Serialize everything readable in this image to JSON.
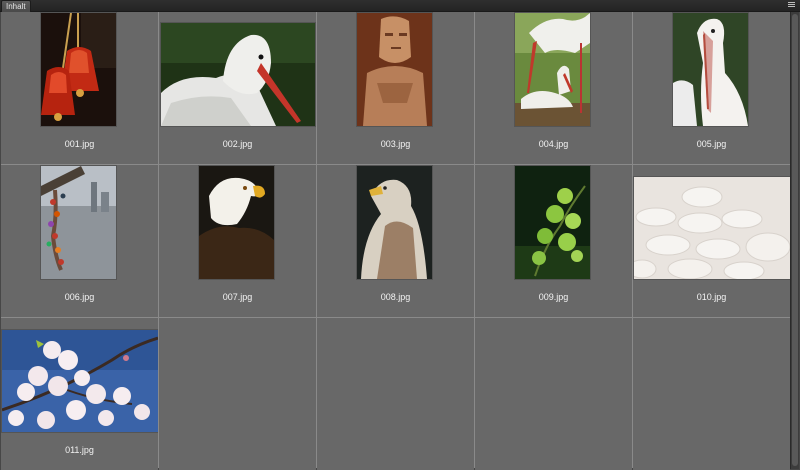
{
  "window": {
    "tab_label": "Inhalt"
  },
  "items": [
    {
      "filename": "001.jpg",
      "subject": "red-christmas-bells"
    },
    {
      "filename": "002.jpg",
      "subject": "white-stork-closeup"
    },
    {
      "filename": "003.jpg",
      "subject": "carved-stone-figure"
    },
    {
      "filename": "004.jpg",
      "subject": "storks-at-nest"
    },
    {
      "filename": "005.jpg",
      "subject": "pelican-closeup"
    },
    {
      "filename": "006.jpg",
      "subject": "love-locks-on-bridge"
    },
    {
      "filename": "007.jpg",
      "subject": "bald-eagle"
    },
    {
      "filename": "008.jpg",
      "subject": "egyptian-vulture"
    },
    {
      "filename": "009.jpg",
      "subject": "green-branch"
    },
    {
      "filename": "010.jpg",
      "subject": "white-tablets"
    },
    {
      "filename": "011.jpg",
      "subject": "cherry-blossoms"
    }
  ],
  "colors": {
    "panel_bg": "#686868",
    "grid_line": "#8a8a8a",
    "titlebar": "#2a2a2a",
    "label_text": "#f2f2f2"
  }
}
